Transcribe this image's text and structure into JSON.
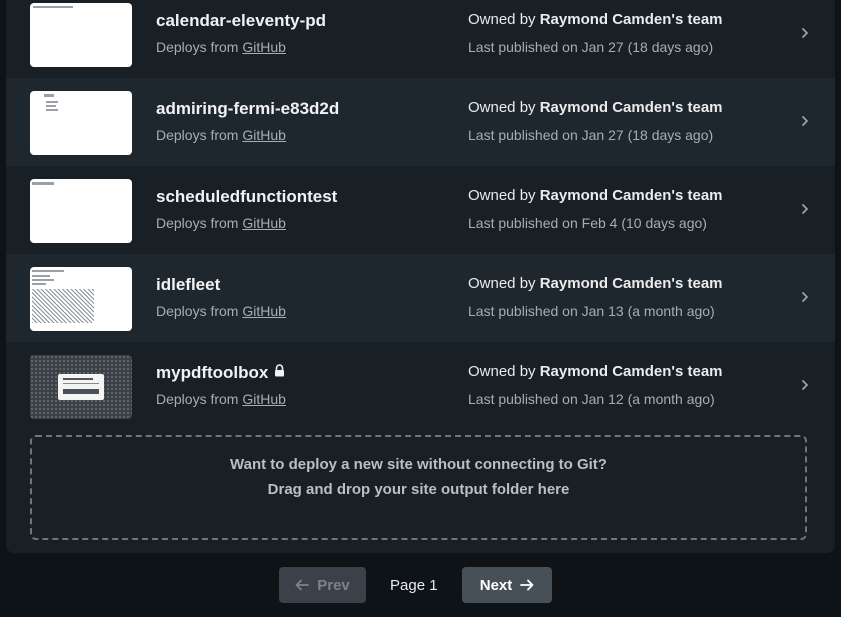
{
  "sites": [
    {
      "name": "calendar-eleventy-pd",
      "deploys_prefix": "Deploys from ",
      "deploys_source": "GitHub",
      "owned_prefix": "Owned by ",
      "owner": "Raymond Camden's team",
      "published": "Last published on Jan 27 (18 days ago)",
      "locked": false
    },
    {
      "name": "admiring-fermi-e83d2d",
      "deploys_prefix": "Deploys from ",
      "deploys_source": "GitHub",
      "owned_prefix": "Owned by ",
      "owner": "Raymond Camden's team",
      "published": "Last published on Jan 27 (18 days ago)",
      "locked": false
    },
    {
      "name": "scheduledfunctiontest",
      "deploys_prefix": "Deploys from ",
      "deploys_source": "GitHub",
      "owned_prefix": "Owned by ",
      "owner": "Raymond Camden's team",
      "published": "Last published on Feb 4 (10 days ago)",
      "locked": false
    },
    {
      "name": "idlefleet",
      "deploys_prefix": "Deploys from ",
      "deploys_source": "GitHub",
      "owned_prefix": "Owned by ",
      "owner": "Raymond Camden's team",
      "published": "Last published on Jan 13 (a month ago)",
      "locked": false
    },
    {
      "name": "mypdftoolbox",
      "deploys_prefix": "Deploys from ",
      "deploys_source": "GitHub",
      "owned_prefix": "Owned by ",
      "owner": "Raymond Camden's team",
      "published": "Last published on Jan 12 (a month ago)",
      "locked": true
    }
  ],
  "dropzone": {
    "line1": "Want to deploy a new site without connecting to Git?",
    "line2": "Drag and drop your site output folder here"
  },
  "pagination": {
    "prev_label": "Prev",
    "page_label": "Page 1",
    "next_label": "Next"
  },
  "icons": {
    "chevron": "chevron-right-icon",
    "lock": "lock-icon",
    "prev_arrow": "arrow-left-icon",
    "next_arrow": "arrow-right-icon"
  },
  "colors": {
    "page_background": "#0e1318",
    "panel_background": "#181f25",
    "row_alternate": "#1f272e",
    "next_button": "#474f57",
    "prev_button_disabled": "#3a4148"
  }
}
